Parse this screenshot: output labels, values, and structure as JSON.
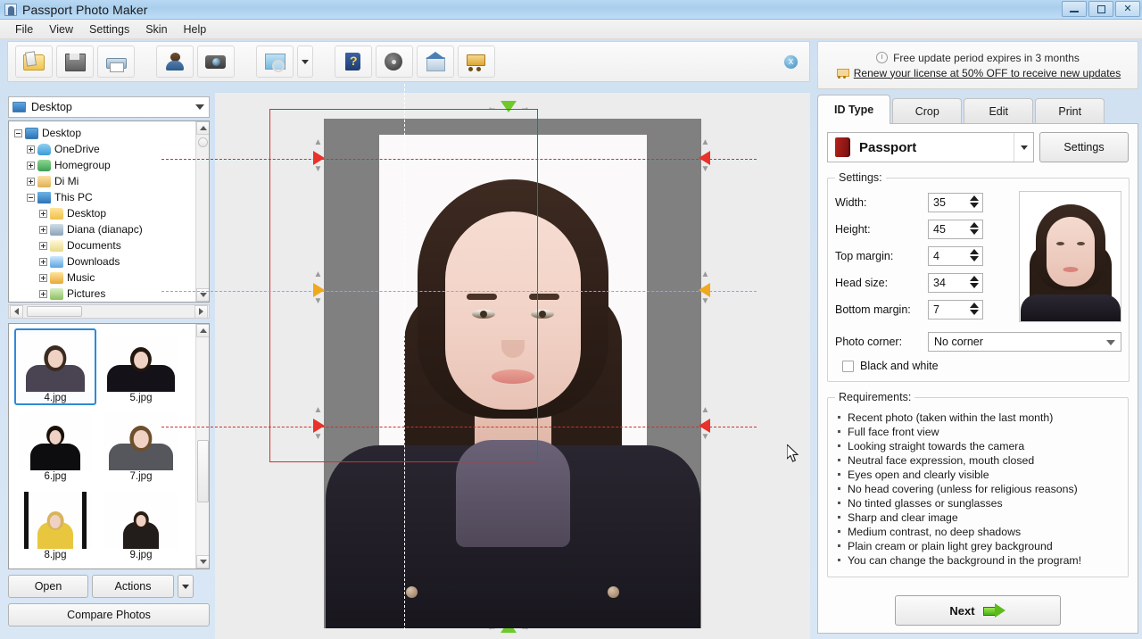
{
  "window": {
    "title": "Passport Photo Maker",
    "icon": "app-icon",
    "controls": {
      "minimize": "minimize",
      "maximize": "maximize",
      "close": "close"
    }
  },
  "menubar": {
    "items": [
      "File",
      "View",
      "Settings",
      "Skin",
      "Help"
    ]
  },
  "toolbar": {
    "buttons": [
      {
        "name": "open-photo",
        "icon": "open-folder-icon"
      },
      {
        "name": "save-photo",
        "icon": "save-icon"
      },
      {
        "name": "print-photo",
        "icon": "print-icon"
      },
      {
        "name": "retouch-person",
        "icon": "person-icon"
      },
      {
        "name": "capture-webcam",
        "icon": "camera-icon"
      },
      {
        "name": "preview-photo",
        "icon": "zoom-image-icon"
      },
      {
        "name": "help-guide",
        "icon": "help-book-icon"
      },
      {
        "name": "video-tutorial",
        "icon": "film-reel-icon"
      },
      {
        "name": "home-upgrade",
        "icon": "home-upgrade-icon"
      },
      {
        "name": "buy-now",
        "icon": "cart-icon"
      }
    ],
    "dropdown_caret": "chevron-down-icon",
    "close_banner": "x"
  },
  "left_panel": {
    "folder_combo": {
      "value": "Desktop",
      "icon": "monitor-icon"
    },
    "tree": [
      {
        "label": "Desktop",
        "indent": 0,
        "icon": "monitor-icon",
        "expander": "minus"
      },
      {
        "label": "OneDrive",
        "indent": 1,
        "icon": "cloud-icon",
        "expander": "plus"
      },
      {
        "label": "Homegroup",
        "indent": 1,
        "icon": "homegroup-icon",
        "expander": "plus"
      },
      {
        "label": "Di Mi",
        "indent": 1,
        "icon": "user-icon",
        "expander": "plus"
      },
      {
        "label": "This PC",
        "indent": 1,
        "icon": "pc-icon",
        "expander": "minus"
      },
      {
        "label": "Desktop",
        "indent": 2,
        "icon": "folder-icon",
        "expander": "plus"
      },
      {
        "label": "Diana (dianapc)",
        "indent": 2,
        "icon": "network-icon",
        "expander": "plus"
      },
      {
        "label": "Documents",
        "indent": 2,
        "icon": "documents-icon",
        "expander": "plus"
      },
      {
        "label": "Downloads",
        "indent": 2,
        "icon": "downloads-icon",
        "expander": "plus"
      },
      {
        "label": "Music",
        "indent": 2,
        "icon": "music-icon",
        "expander": "plus"
      },
      {
        "label": "Pictures",
        "indent": 2,
        "icon": "pictures-icon",
        "expander": "plus"
      }
    ],
    "thumbnails": [
      {
        "name": "4.jpg",
        "selected": true
      },
      {
        "name": "5.jpg",
        "selected": false
      },
      {
        "name": "6.jpg",
        "selected": false
      },
      {
        "name": "7.jpg",
        "selected": false
      },
      {
        "name": "8.jpg",
        "selected": false
      },
      {
        "name": "9.jpg",
        "selected": false
      }
    ],
    "buttons": {
      "open": "Open",
      "actions": "Actions",
      "actions_caret": "chevron-down-icon",
      "compare": "Compare Photos"
    }
  },
  "canvas": {
    "markers": {
      "top_handle": "green-triangle-down",
      "bottom_handle": "green-triangle-up",
      "head_top_line": "red-dashed-guide",
      "eye_line": "yellow-dashed-guide",
      "chin_line": "red-dashed-guide",
      "center_line": "white-dashed-guide"
    },
    "cursor": "arrow-move-cursor"
  },
  "right_panel": {
    "license": {
      "clock_icon": "clock-icon",
      "notice": "Free update period expires in 3 months",
      "cart_icon": "cart-icon",
      "link": "Renew your license at 50% OFF to receive new updates"
    },
    "tabs": [
      {
        "label": "ID Type",
        "active": true
      },
      {
        "label": "Crop",
        "active": false
      },
      {
        "label": "Edit",
        "active": false
      },
      {
        "label": "Print",
        "active": false
      }
    ],
    "id_type": {
      "selected": "Passport",
      "icon": "passport-book-icon",
      "dropdown_caret": "chevron-down-icon",
      "settings_button": "Settings"
    },
    "settings": {
      "legend": "Settings:",
      "fields": [
        {
          "label": "Width:",
          "value": "35"
        },
        {
          "label": "Height:",
          "value": "45"
        },
        {
          "label": "Top margin:",
          "value": "4"
        },
        {
          "label": "Head size:",
          "value": "34"
        },
        {
          "label": "Bottom margin:",
          "value": "7"
        }
      ],
      "photo_corner": {
        "label": "Photo corner:",
        "value": "No corner"
      },
      "black_and_white": {
        "label": "Black and white",
        "checked": false
      },
      "preview": "passport-photo-preview"
    },
    "requirements": {
      "legend": "Requirements:",
      "items": [
        "Recent photo (taken within the last month)",
        "Full face front view",
        "Looking straight towards the camera",
        "Neutral face expression, mouth closed",
        "Eyes open and clearly visible",
        "No head covering (unless for religious reasons)",
        "No tinted glasses or sunglasses",
        "Sharp and clear image",
        "Medium contrast, no deep shadows",
        "Plain cream or plain light grey background",
        "You can change the background in the program!"
      ]
    },
    "next_button": {
      "label": "Next",
      "icon": "green-arrow-right-icon"
    }
  },
  "colors": {
    "titlebar": "#b5d6f0",
    "accent_blue": "#2e8ad6",
    "guide_red": "#d0302a",
    "guide_yellow": "#e2a312",
    "handle_green": "#6ec92b",
    "canvas_bg": "#ececec",
    "photo_bg": "#808080"
  }
}
